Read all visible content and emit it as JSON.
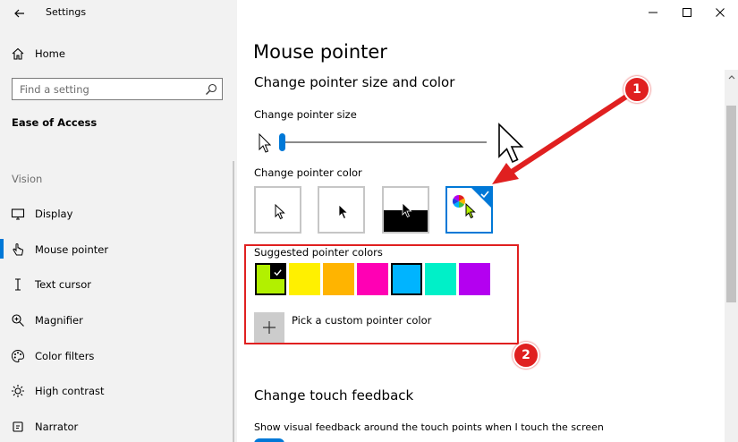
{
  "window": {
    "title": "Settings",
    "controls": {
      "minimize": "minimize",
      "maximize": "maximize",
      "close": "close"
    }
  },
  "sidebar": {
    "home_label": "Home",
    "search": {
      "placeholder": "Find a setting",
      "value": ""
    },
    "section_title": "Ease of Access",
    "group_label": "Vision",
    "items": [
      {
        "label": "Display",
        "icon": "monitor-icon"
      },
      {
        "label": "Mouse pointer",
        "icon": "pointer-hand-icon",
        "active": true
      },
      {
        "label": "Text cursor",
        "icon": "text-cursor-icon"
      },
      {
        "label": "Magnifier",
        "icon": "magnifier-icon"
      },
      {
        "label": "Color filters",
        "icon": "palette-icon"
      },
      {
        "label": "High contrast",
        "icon": "sun-icon"
      },
      {
        "label": "Narrator",
        "icon": "narrator-icon"
      }
    ]
  },
  "main": {
    "page_title": "Mouse pointer",
    "size_color_heading": "Change pointer size and color",
    "size_label": "Change pointer size",
    "size_level": 0.0,
    "color_label": "Change pointer color",
    "color_options": [
      {
        "name": "white",
        "selected": false
      },
      {
        "name": "black",
        "selected": false
      },
      {
        "name": "inverted",
        "selected": false
      },
      {
        "name": "custom",
        "selected": true
      }
    ],
    "suggested_label": "Suggested pointer colors",
    "suggested_colors": [
      "#b2f000",
      "#fff000",
      "#ffb400",
      "#ff00b4",
      "#00b4ff",
      "#00f0c8",
      "#b400f0"
    ],
    "selected_swatch": 0,
    "custom_color_label": "Pick a custom pointer color",
    "touch_heading": "Change touch feedback",
    "touch_desc": "Show visual feedback around the touch points when I touch the screen"
  },
  "annotations": {
    "badge_1": "1",
    "badge_2": "2"
  },
  "colors": {
    "accent": "#0078d7",
    "annotation": "#e02020"
  }
}
